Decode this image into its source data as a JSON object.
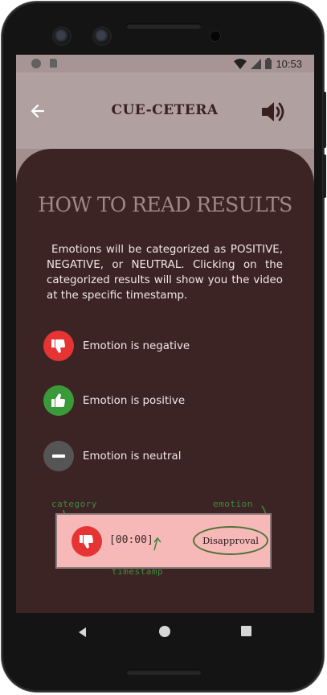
{
  "status_bar": {
    "time": "10:53",
    "icons": [
      "notification-dot",
      "sd-card-icon",
      "wifi-icon",
      "signal-icon",
      "battery-icon"
    ]
  },
  "app_bar": {
    "title": "CUE-CETERA",
    "back_icon": "arrow-left-icon",
    "volume_icon": "volume-icon"
  },
  "content": {
    "heading": "HOW TO READ RESULTS",
    "description": "Emotions will be categorized as POSITIVE, NEGATIVE, or NEUTRAL. Clicking on the categorized results will show you the video at the specific timestamp.",
    "legend": [
      {
        "label": "Emotion is negative",
        "icon": "thumbs-down-icon",
        "color": "#e63434"
      },
      {
        "label": "Emotion is positive",
        "icon": "thumbs-up-icon",
        "color": "#3a9a3a"
      },
      {
        "label": "Emotion is neutral",
        "icon": "minus-icon",
        "color": "#555555"
      }
    ],
    "example": {
      "timestamp": "[00:00]",
      "emotion": "Disapproval",
      "annotations": {
        "category": "category",
        "timestamp": "timestamp",
        "emotion": "emotion"
      }
    }
  },
  "colors": {
    "app_bar": "#b0a0a0",
    "card": "#3d2424",
    "heading": "#a08888",
    "negative": "#e63434",
    "positive": "#3a9a3a",
    "neutral": "#555555",
    "example_bg": "#f7b8b8",
    "annotation": "#3f8a3c"
  },
  "nav_bar": {
    "icons": [
      "nav-back-icon",
      "nav-home-icon",
      "nav-recents-icon"
    ]
  }
}
